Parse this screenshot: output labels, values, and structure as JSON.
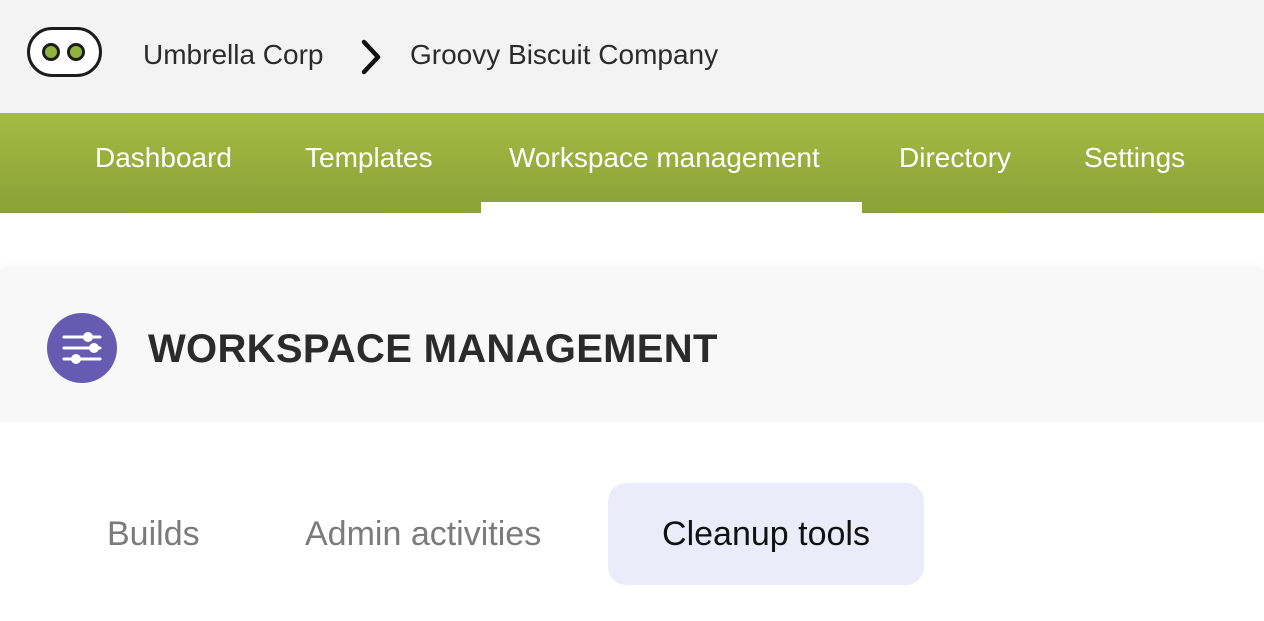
{
  "breadcrumb": {
    "items": [
      "Umbrella Corp",
      "Groovy Biscuit Company"
    ],
    "logo_icon": "two-eyes-logo-icon",
    "separator_icon": "chevron-right-icon"
  },
  "nav": {
    "items": [
      "Dashboard",
      "Templates",
      "Workspace management",
      "Directory",
      "Settings"
    ],
    "active": "Workspace management",
    "colors": {
      "gradient_top": "#a5bb44",
      "gradient_bottom": "#8aa137"
    }
  },
  "section": {
    "title": "WORKSPACE MANAGEMENT",
    "icon": "sliders-icon",
    "icon_color": "#665bb0"
  },
  "tabs": {
    "items": [
      "Builds",
      "Admin activities",
      "Cleanup tools"
    ],
    "active": "Cleanup tools",
    "active_bg": "#ecebfa"
  }
}
